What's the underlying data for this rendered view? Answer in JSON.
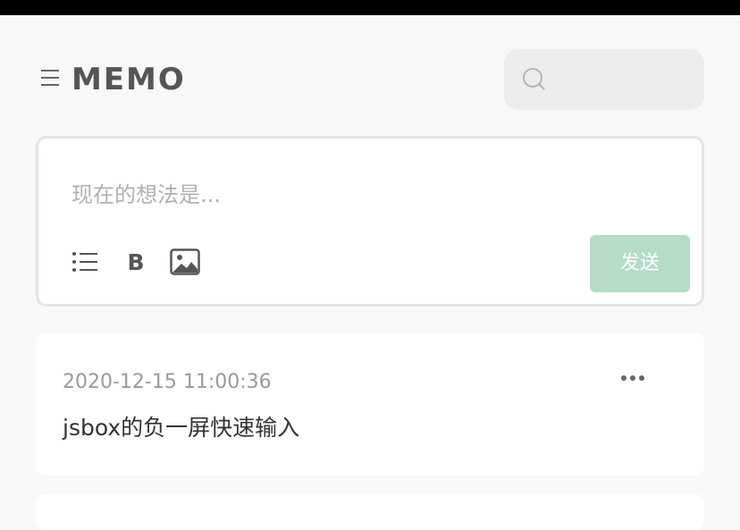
{
  "header": {
    "title": "MEMO",
    "menu_icon": "menu-icon",
    "search_icon": "search-icon"
  },
  "editor": {
    "placeholder": "现在的想法是...",
    "tools": [
      "list-icon",
      "bold-icon",
      "image-icon"
    ],
    "bold_label": "B",
    "send_label": "发送"
  },
  "memos": [
    {
      "timestamp": "2020-12-15 11:00:36",
      "content": "jsbox的负一屏快速输入",
      "more_icon": "more-icon"
    }
  ],
  "colors": {
    "accent_disabled": "#b4dcc6",
    "background": "#f8f8f8",
    "card": "#ffffff",
    "title": "#555555"
  }
}
